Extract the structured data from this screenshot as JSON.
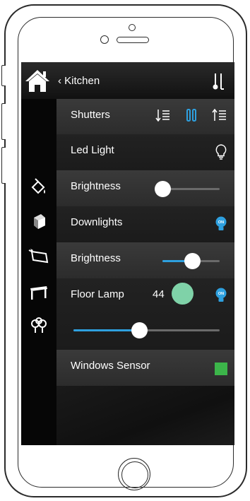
{
  "header": {
    "back_label": "Kitchen"
  },
  "sidebar": {
    "icons": [
      "paint-bucket-icon",
      "cube-icon",
      "laptop-icon",
      "table-icon",
      "tree-icon"
    ]
  },
  "rows": {
    "shutters": {
      "label": "Shutters"
    },
    "led_light": {
      "label": "Led Light",
      "icon": "bulb-off-icon"
    },
    "brightness_1": {
      "label": "Brightness",
      "level": 0.0
    },
    "downlights": {
      "label": "Downlights",
      "badge": "ON"
    },
    "brightness_2": {
      "label": "Brightness",
      "level": 0.52
    },
    "floor_lamp": {
      "label": "Floor Lamp",
      "value": "44",
      "badge": "ON",
      "color": "#7fd2a8",
      "slider_level": 0.45
    },
    "windows_sensor": {
      "label": "Windows Sensor",
      "status_color": "#3cb54a"
    }
  },
  "colors": {
    "accent": "#2ea0df",
    "on_badge": "#2ea0df",
    "sensor": "#3cb54a",
    "lamp_color": "#7fd2a8"
  }
}
